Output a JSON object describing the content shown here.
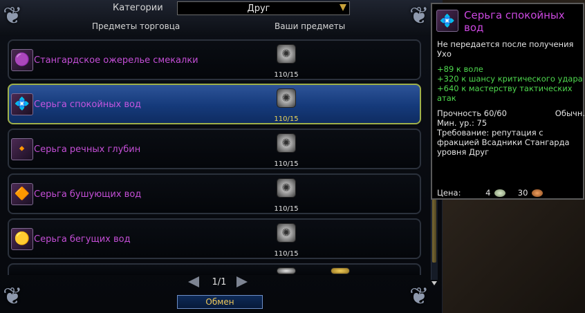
{
  "categories": {
    "label": "Категории",
    "value": "Друг"
  },
  "headers": {
    "merchant_items": "Предметы торговца",
    "your_items": "Ваши предметы"
  },
  "rows": [
    {
      "name": "Стангардское ожерелье смекалки",
      "qty": "110/15",
      "icon": "necklace-icon"
    },
    {
      "name": "Серьга спокойных вод",
      "qty": "110/15",
      "icon": "earring-icon",
      "selected": true
    },
    {
      "name": "Серьга речных глубин",
      "qty": "110/15",
      "icon": "earring-icon"
    },
    {
      "name": "Серьга бушующих вод",
      "qty": "110/15",
      "icon": "earring-icon"
    },
    {
      "name": "Серьга бегущих вод",
      "qty": "110/15",
      "icon": "earring-icon"
    }
  ],
  "pagination": {
    "text": "1/1"
  },
  "exchange_button": "Обмен",
  "tooltip": {
    "title": "Серьга спокойных вод",
    "bind_line": "Не передается после получения",
    "slot": "Ухо",
    "bonus1": "+89 к воле",
    "bonus2": "+320 к шансу критического удара",
    "bonus3": "+640 к мастерству тактических атак",
    "durability": "Прочность 60/60",
    "quality": "Обычн.",
    "min_level": "Мин. ур.: 75",
    "requirement": "Требование: репутация с фракцией Всадники Стангарда уровня Друг",
    "price_label": "Цена:",
    "price_silver": "4",
    "price_copper": "30"
  },
  "colors": {
    "item_name": "#c44ed6",
    "selected_row": "#1f4a92",
    "selected_border": "#9fb04a",
    "bonus_green": "#4ed84e",
    "tooltip_title": "#cc48e0",
    "button_text": "#f0c95a"
  }
}
